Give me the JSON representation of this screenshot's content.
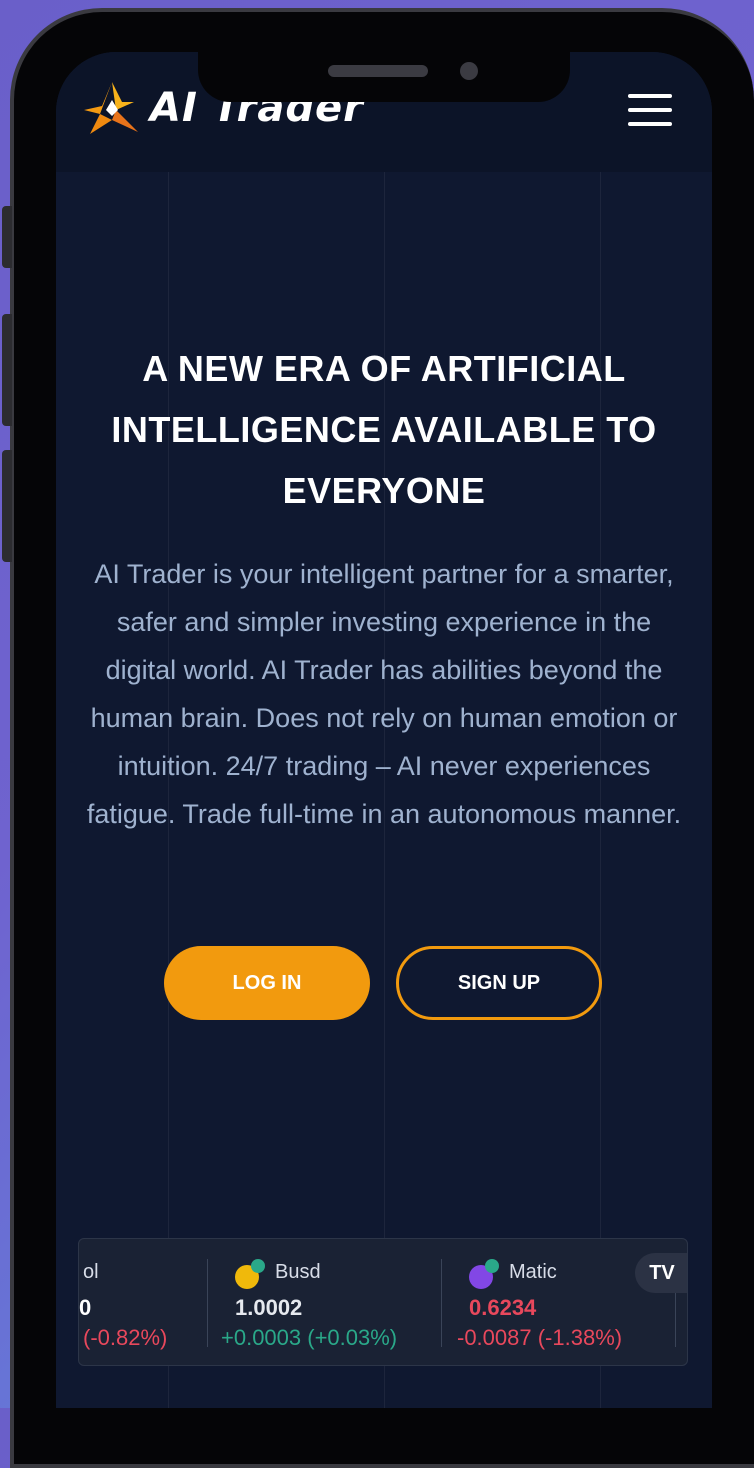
{
  "header": {
    "logo_text": "AI Trader"
  },
  "hero": {
    "title": "A NEW ERA OF ARTIFICIAL INTELLIGENCE AVAILABLE TO EVERYONE",
    "description": "AI Trader is your intelligent partner for a smarter, safer and simpler investing experience in the digital world. AI Trader has abilities beyond the human brain. Does not rely on human emotion or intuition. 24/7 trading – AI never experiences fatigue. Trade full-time in an autonomous manner."
  },
  "buttons": {
    "login_label": "LOG IN",
    "signup_label": "SIGN UP"
  },
  "ticker": {
    "items": [
      {
        "name": "ol",
        "price": "0",
        "change": "(-0.82%)",
        "trend": "down"
      },
      {
        "name": "Busd",
        "price": "1.0002",
        "change": "+0.0003 (+0.03%)",
        "trend": "up"
      },
      {
        "name": "Matic",
        "price": "0.6234",
        "change": "-0.0087 (-1.38%)",
        "trend": "down"
      }
    ],
    "badge": "TV"
  },
  "colors": {
    "accent": "#f29a0e",
    "up": "#2aa889",
    "down": "#e8485c",
    "background": "#0f1830"
  }
}
